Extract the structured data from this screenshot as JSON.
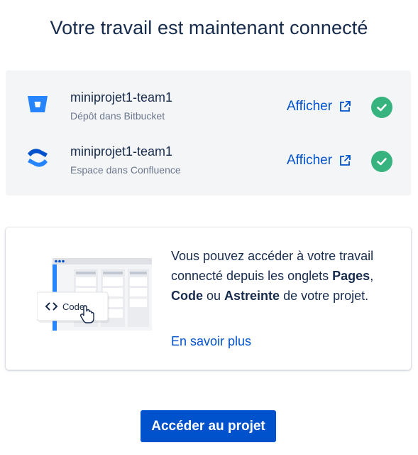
{
  "title": "Votre travail est maintenant connecté",
  "links": [
    {
      "name": "miniprojet1-team1",
      "subtitle": "Dépôt dans Bitbucket",
      "action": "Afficher",
      "icon": "bitbucket-icon",
      "status_icon": "check-circle-icon"
    },
    {
      "name": "miniprojet1-team1",
      "subtitle": "Espace dans Confluence",
      "action": "Afficher",
      "icon": "confluence-icon",
      "status_icon": "check-circle-icon"
    }
  ],
  "info": {
    "line1": "Vous pouvez accéder à votre travail connecté depuis les onglets ",
    "tab_pages": "Pages",
    "sep1": ", ",
    "tab_code": "Code",
    "sep2": " ou ",
    "tab_oncall": "Astreinte",
    "line_end": " de votre projet.",
    "learn_more": "En savoir plus",
    "illustration_label": "Code"
  },
  "cta_label": "Accéder au projet",
  "colors": {
    "brand_blue": "#0052cc",
    "success_green": "#36b37e",
    "text_primary": "#172b4d",
    "text_subtle": "#6b778c",
    "panel_bg": "#f4f5f7",
    "bitbucket": "#2684ff",
    "confluence": "#0052cc"
  }
}
